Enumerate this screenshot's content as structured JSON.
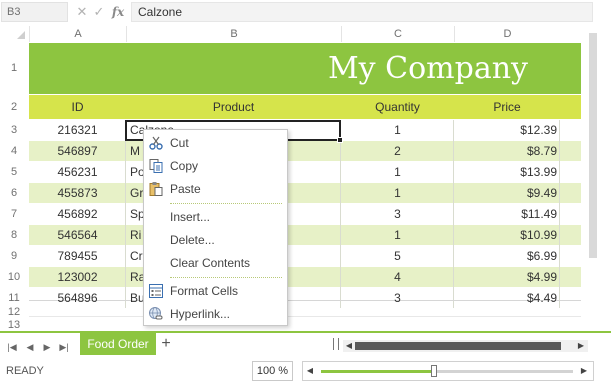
{
  "formula_bar": {
    "cell_ref": "B3",
    "cancel_icon": "x-icon",
    "confirm_icon": "check-icon",
    "fx_label": "fx",
    "value": "Calzone"
  },
  "columns": [
    "A",
    "B",
    "C",
    "D"
  ],
  "rows": [
    "1",
    "2",
    "3",
    "4",
    "5",
    "6",
    "7",
    "8",
    "9",
    "10",
    "11",
    "12",
    "13"
  ],
  "title": "My Company",
  "headers": {
    "id": "ID",
    "product": "Product",
    "quantity": "Quantity",
    "price": "Price"
  },
  "data_rows": [
    {
      "id": "216321",
      "product": "Calzone",
      "quantity": "1",
      "price": "$12.39"
    },
    {
      "id": "546897",
      "product": "M",
      "quantity": "2",
      "price": "$8.79"
    },
    {
      "id": "456231",
      "product": "Po",
      "quantity": "1",
      "price": "$13.99"
    },
    {
      "id": "455873",
      "product": "Gr",
      "quantity": "1",
      "price": "$9.49"
    },
    {
      "id": "456892",
      "product": "Sp",
      "quantity": "3",
      "price": "$11.49"
    },
    {
      "id": "546564",
      "product": "Ri",
      "quantity": "1",
      "price": "$10.99"
    },
    {
      "id": "789455",
      "product": "Cr",
      "quantity": "5",
      "price": "$6.99"
    },
    {
      "id": "123002",
      "product": "Ra",
      "quantity": "4",
      "price": "$4.99"
    },
    {
      "id": "564896",
      "product": "Bu",
      "quantity": "3",
      "price": "$4.49"
    }
  ],
  "context_menu": {
    "cut": "Cut",
    "copy": "Copy",
    "paste": "Paste",
    "insert": "Insert...",
    "delete": "Delete...",
    "clear_contents": "Clear Contents",
    "format_cells": "Format Cells",
    "hyperlink": "Hyperlink..."
  },
  "sheet_tabs": {
    "active": "Food Order",
    "add_label": "+"
  },
  "status": {
    "text": "READY",
    "zoom": "100 %",
    "zoom_fraction": 0.45
  },
  "colors": {
    "accent": "#8dc540",
    "header_band": "#d6e44b",
    "alt_row": "#e7f1c7"
  }
}
